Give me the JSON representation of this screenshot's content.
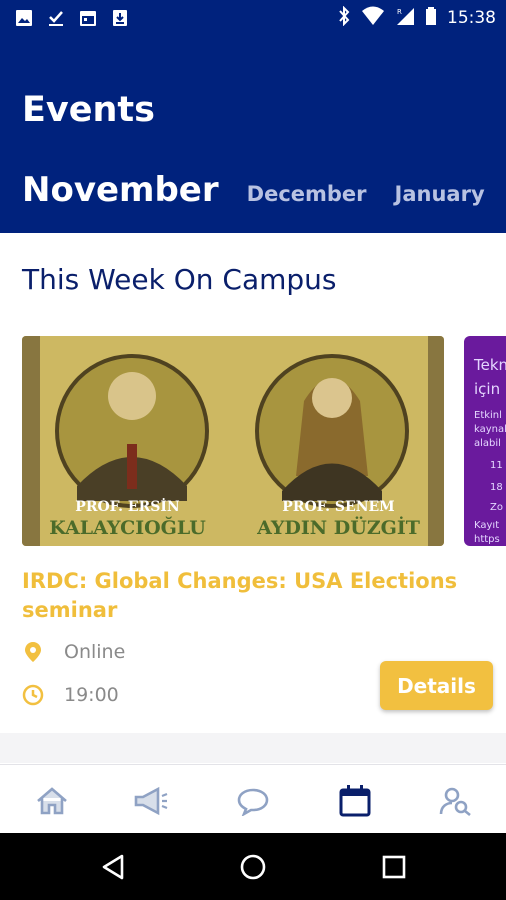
{
  "status_bar": {
    "time": "15:38",
    "left_icons": [
      "image-icon",
      "download-check-icon",
      "calendar-icon",
      "download-icon"
    ],
    "right_icons": [
      "bluetooth-icon",
      "wifi-icon",
      "signal-icon",
      "battery-icon"
    ]
  },
  "header": {
    "title": "Events",
    "months": [
      {
        "label": "November",
        "active": true
      },
      {
        "label": "December",
        "active": false
      },
      {
        "label": "January",
        "active": false
      }
    ]
  },
  "section": {
    "title": "This Week On Campus"
  },
  "event": {
    "image_names": [
      "PROF. ERSİN",
      "KALAYCIOĞLU",
      "PROF. SENEM",
      "AYDIN DÜZGİT"
    ],
    "title": "IRDC: Global Changes: USA Elections seminar",
    "location": "Online",
    "time": "19:00",
    "details_label": "Details"
  },
  "next_card_peek": {
    "lines": [
      "Tekn",
      "için",
      "Etkinl",
      "kaynak",
      "alabil",
      "11",
      "18",
      "Zo",
      "Kayıt",
      "https"
    ]
  },
  "bottom_nav": [
    "home-icon",
    "megaphone-icon",
    "chat-icon",
    "calendar-icon",
    "user-search-icon"
  ],
  "colors": {
    "header": "#00227d",
    "accent": "#f2c040",
    "section_title": "#0a1f6b",
    "nav_icon": "#8fa2c4",
    "nav_active": "#0a1f6b"
  }
}
